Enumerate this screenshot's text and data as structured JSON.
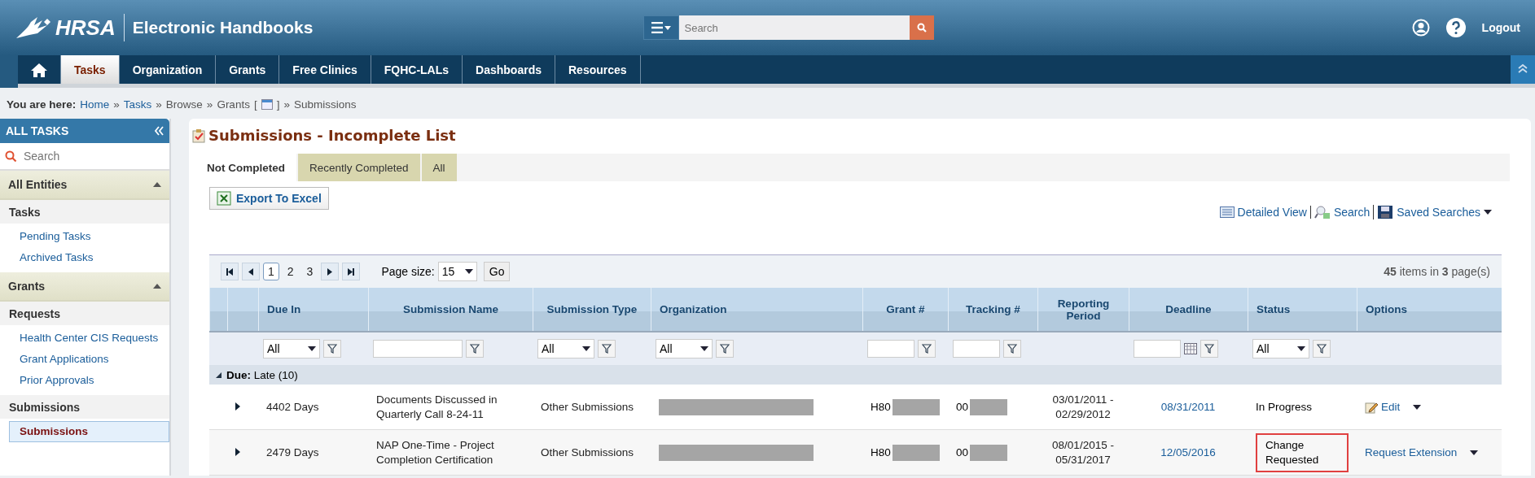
{
  "header": {
    "logo": "HRSA",
    "app_title": "Electronic Handbooks",
    "search": {
      "placeholder": "Search"
    },
    "logout": "Logout"
  },
  "nav": [
    {
      "kind": "home",
      "selected": false
    },
    {
      "kind": "tab",
      "label": "Tasks",
      "selected": true
    },
    {
      "kind": "tab",
      "label": "Organization",
      "selected": false
    },
    {
      "kind": "tab",
      "label": "Grants",
      "selected": false
    },
    {
      "kind": "tab",
      "label": "Free Clinics",
      "selected": false
    },
    {
      "kind": "tab",
      "label": "FQHC-LALs",
      "selected": false
    },
    {
      "kind": "tab",
      "label": "Dashboards",
      "selected": false
    },
    {
      "kind": "tab",
      "label": "Resources",
      "selected": false
    }
  ],
  "breadcrumb": {
    "prefix": "You are here:",
    "separator": "»",
    "items": [
      {
        "kind": "link",
        "label": "Home"
      },
      {
        "kind": "link",
        "label": "Tasks"
      },
      {
        "kind": "text",
        "label": "Browse"
      },
      {
        "kind": "picker",
        "label": "Grants",
        "open": "[",
        "close": "]"
      },
      {
        "kind": "text",
        "label": "Submissions"
      }
    ]
  },
  "sidebar": {
    "title": "ALL TASKS",
    "search": {
      "placeholder": "Search"
    },
    "sections": [
      {
        "title": "All Entities",
        "expanded": true,
        "groups": [
          {
            "title": "Tasks",
            "items": [
              {
                "label": "Pending Tasks",
                "selected": false
              },
              {
                "label": "Archived Tasks",
                "selected": false
              }
            ]
          }
        ]
      },
      {
        "title": "Grants",
        "expanded": true,
        "groups": [
          {
            "title": "Requests",
            "items": [
              {
                "label": "Health Center CIS Requests",
                "selected": false
              },
              {
                "label": "Grant Applications",
                "selected": false
              },
              {
                "label": "Prior Approvals",
                "selected": false
              }
            ]
          },
          {
            "title": "Submissions",
            "items": [
              {
                "label": "Submissions",
                "selected": true
              }
            ]
          }
        ]
      }
    ]
  },
  "main": {
    "title": "Submissions - Incomplete List",
    "tabs": [
      {
        "label": "Not Completed",
        "selected": true
      },
      {
        "label": "Recently Completed",
        "selected": false
      },
      {
        "label": "All",
        "selected": false
      }
    ],
    "export": "Export To Excel",
    "tools": [
      {
        "kind": "list",
        "label": "Detailed View"
      },
      {
        "kind": "search",
        "label": "Search"
      },
      {
        "kind": "save",
        "label": "Saved Searches"
      }
    ],
    "pager": {
      "pages": [
        {
          "label": "1",
          "selected": true
        },
        {
          "label": "2",
          "selected": false
        },
        {
          "label": "3",
          "selected": false
        }
      ],
      "page_size_label": "Page size:",
      "page_size": "15",
      "go": "Go",
      "summary": "**45** items in **3** page(s)"
    },
    "columns": [
      {
        "label": "Due In",
        "kind": "select",
        "value": "All"
      },
      {
        "label": "Submission Name",
        "kind": "text"
      },
      {
        "label": "Submission Type",
        "kind": "select",
        "value": "All"
      },
      {
        "label": "Organization",
        "kind": "select",
        "value": "All"
      },
      {
        "label": "Grant #",
        "kind": "text"
      },
      {
        "label": "Tracking #",
        "kind": "text"
      },
      {
        "label": "Reporting Period",
        "kind": "none"
      },
      {
        "label": "Deadline",
        "kind": "date"
      },
      {
        "label": "Status",
        "kind": "select",
        "value": "All"
      },
      {
        "label": "Options",
        "kind": "none"
      }
    ],
    "group": {
      "expanded": true,
      "label": "Due:",
      "value": "Late (10)"
    },
    "rows": [
      {
        "due_in": "4402 Days",
        "name": "Documents Discussed in Quarterly Call 8-24-11",
        "type": "Other Submissions",
        "grant": "H80",
        "tracking": "00",
        "period": "03/01/2011 - 02/29/2012",
        "deadline": "08/31/2011",
        "status": "In Progress",
        "highlighted": false,
        "option": {
          "kind": "edit",
          "label": "Edit"
        }
      },
      {
        "due_in": "2479 Days",
        "name": "NAP One-Time - Project Completion Certification",
        "type": "Other Submissions",
        "grant": "H80",
        "tracking": "00",
        "period": "08/01/2015 - 05/31/2017",
        "deadline": "12/05/2016",
        "status": "Change Requested",
        "highlighted": true,
        "option": {
          "kind": "link",
          "label": "Request Extension"
        }
      }
    ]
  }
}
